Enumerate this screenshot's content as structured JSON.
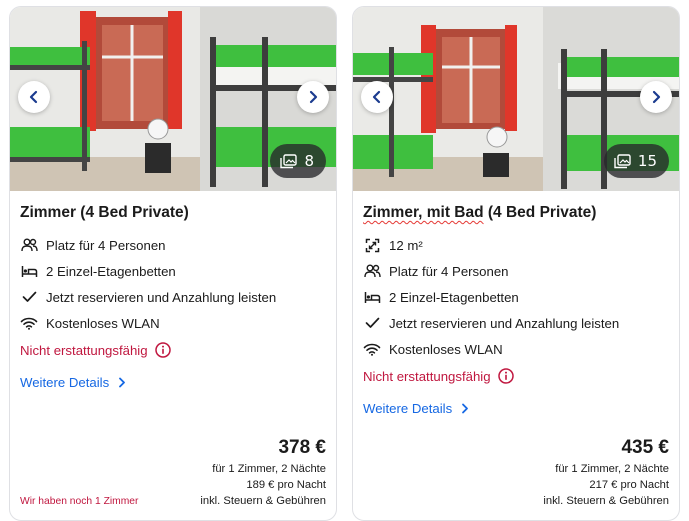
{
  "cards": [
    {
      "photo_count": "8",
      "title_part1": "Zimmer",
      "title_part2": " (4 Bed Private)",
      "features": [
        {
          "icon": "people-icon",
          "text": "Platz für 4 Personen"
        },
        {
          "icon": "bed-icon",
          "text": "2 Einzel-Etagenbetten"
        },
        {
          "icon": "check-icon",
          "text": "Jetzt reservieren und Anzahlung leisten"
        },
        {
          "icon": "wifi-icon",
          "text": "Kostenloses WLAN"
        }
      ],
      "nonrefundable": "Nicht erstattungsfähig",
      "details": "Weitere Details",
      "price": "378 €",
      "price_lines": [
        "für 1 Zimmer, 2 Nächte",
        "189 € pro Nacht",
        "inkl. Steuern & Gebühren"
      ],
      "rooms_left": "Wir haben noch 1 Zimmer"
    },
    {
      "photo_count": "15",
      "title_part1": "Zimmer, mit Bad",
      "title_part2": " (4 Bed Private)",
      "features": [
        {
          "icon": "area-icon",
          "text": "12 m²"
        },
        {
          "icon": "people-icon",
          "text": "Platz für 4 Personen"
        },
        {
          "icon": "bed-icon",
          "text": "2 Einzel-Etagenbetten"
        },
        {
          "icon": "check-icon",
          "text": "Jetzt reservieren und Anzahlung leisten"
        },
        {
          "icon": "wifi-icon",
          "text": "Kostenloses WLAN"
        }
      ],
      "nonrefundable": "Nicht erstattungsfähig",
      "details": "Weitere Details",
      "price": "435 €",
      "price_lines": [
        "für 1 Zimmer, 2 Nächte",
        "217 € pro Nacht",
        "inkl. Steuern & Gebühren"
      ]
    }
  ],
  "colors": {
    "link": "#1668e3",
    "warning": "#c0173f",
    "bedding": "#3fbf3f",
    "curtain": "#d8362a"
  }
}
